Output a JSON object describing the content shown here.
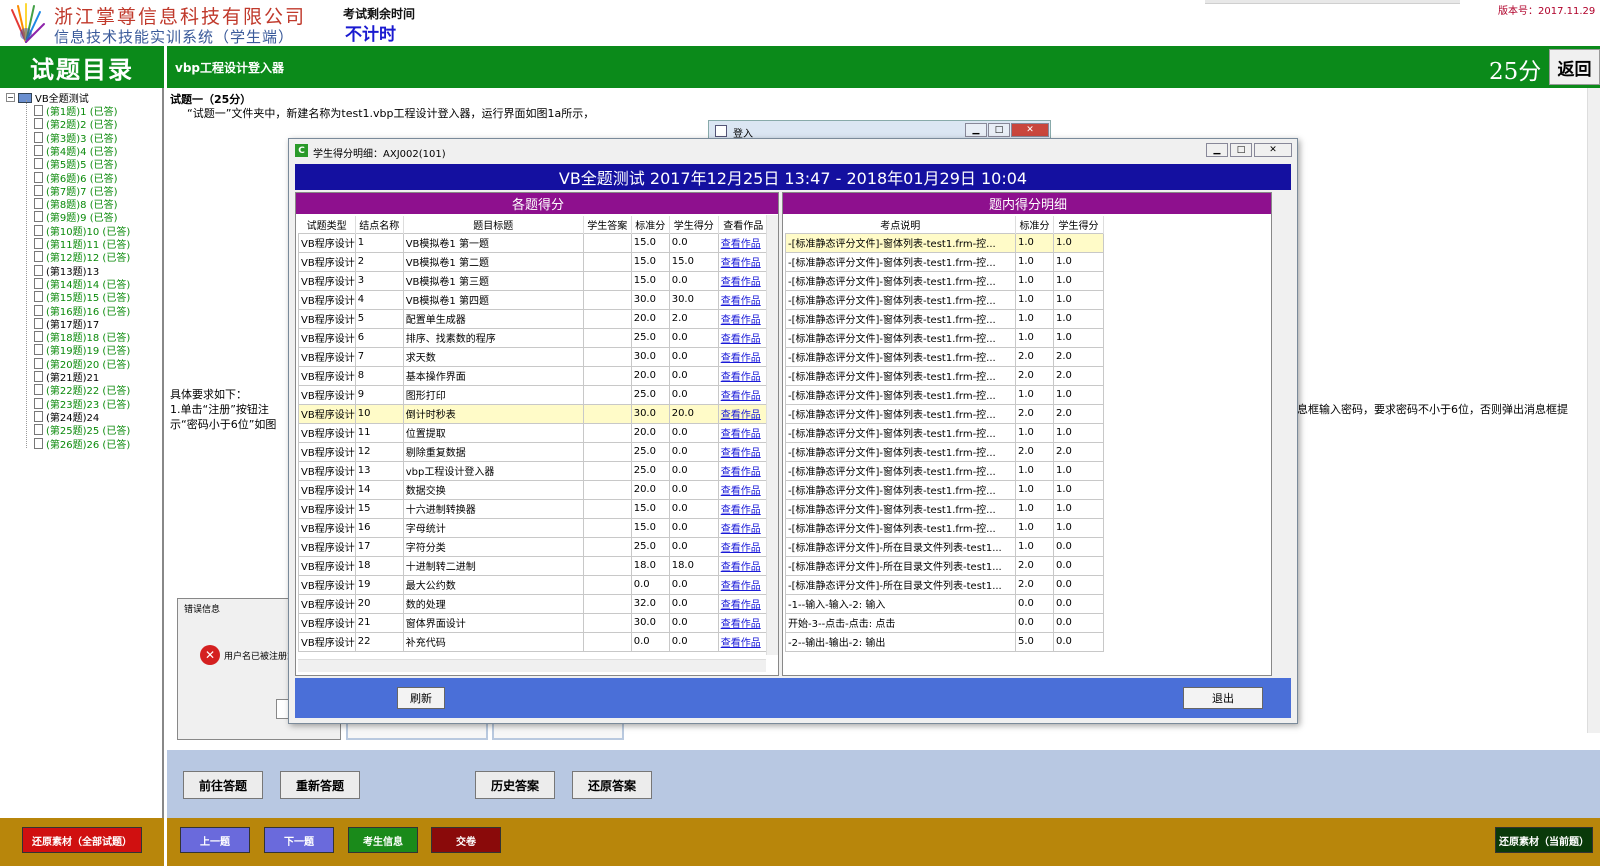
{
  "header": {
    "company": "浙江掌尊信息科技有限公司",
    "system": "信息技术技能实训系统（学生端）",
    "time_label": "考试剩余时间",
    "time_value": "不计时",
    "version": "版本号：2017.11.29"
  },
  "green_bar": {
    "catalog_title": "试题目录",
    "question_title": "vbp工程设计登入器",
    "score": "25分",
    "back_label": "返回"
  },
  "tree": {
    "root": "VB全题测试",
    "items": [
      {
        "label": "(第1题)1 (已答)",
        "done": true
      },
      {
        "label": "(第2题)2 (已答)",
        "done": true
      },
      {
        "label": "(第3题)3 (已答)",
        "done": true
      },
      {
        "label": "(第4题)4 (已答)",
        "done": true
      },
      {
        "label": "(第5题)5 (已答)",
        "done": true
      },
      {
        "label": "(第6题)6 (已答)",
        "done": true
      },
      {
        "label": "(第7题)7 (已答)",
        "done": true
      },
      {
        "label": "(第8题)8 (已答)",
        "done": true
      },
      {
        "label": "(第9题)9 (已答)",
        "done": true
      },
      {
        "label": "(第10题)10 (已答)",
        "done": true
      },
      {
        "label": "(第11题)11 (已答)",
        "done": true
      },
      {
        "label": "(第12题)12 (已答)",
        "done": true
      },
      {
        "label": "(第13题)13",
        "done": false
      },
      {
        "label": "(第14题)14 (已答)",
        "done": true
      },
      {
        "label": "(第15题)15 (已答)",
        "done": true
      },
      {
        "label": "(第16题)16 (已答)",
        "done": true
      },
      {
        "label": "(第17题)17",
        "done": false
      },
      {
        "label": "(第18题)18 (已答)",
        "done": true
      },
      {
        "label": "(第19题)19 (已答)",
        "done": true
      },
      {
        "label": "(第20题)20 (已答)",
        "done": true
      },
      {
        "label": "(第21题)21",
        "done": false
      },
      {
        "label": "(第22题)22 (已答)",
        "done": true
      },
      {
        "label": "(第23题)23 (已答)",
        "done": true
      },
      {
        "label": "(第24题)24",
        "done": false
      },
      {
        "label": "(第25题)25 (已答)",
        "done": true
      },
      {
        "label": "(第26题)26 (已答)",
        "done": true
      }
    ]
  },
  "question": {
    "head": "试题一（25分）",
    "text": "“试题一”文件夹中，新建名称为test1.vbp工程设计登入器，运行界面如图1a所示，",
    "req_1": "具体要求如下：",
    "req_2": "1.单击“注册”按钮注",
    "req_3": "示“密码小于6位”如图",
    "req_right": "息框输入密码，要求密码不小于6位，否则弹出消息框提"
  },
  "login_dialog": {
    "title": "登入"
  },
  "error_dialog": {
    "title": "错误信息",
    "text": "用户名已被注册或不"
  },
  "score_dialog": {
    "title": "学生得分明细：AXJ002(101)",
    "banner": "VB全题测试 2017年12月25日 13:47 - 2018年01月29日 10:04",
    "left_panel_title": "各题得分",
    "right_panel_title": "题内得分明细",
    "left_columns": [
      "试题类型",
      "结点名称",
      "题目标题",
      "学生答案",
      "标准分",
      "学生得分",
      "查看作品"
    ],
    "right_columns": [
      "考点说明",
      "标准分",
      "学生得分"
    ],
    "left_rows": [
      [
        "VB程序设计",
        "1",
        "VB模拟卷1 第一题",
        "",
        "15.0",
        "0.0",
        "查看作品"
      ],
      [
        "VB程序设计",
        "2",
        "VB模拟卷1 第二题",
        "",
        "15.0",
        "15.0",
        "查看作品"
      ],
      [
        "VB程序设计",
        "3",
        "VB模拟卷1 第三题",
        "",
        "15.0",
        "0.0",
        "查看作品"
      ],
      [
        "VB程序设计",
        "4",
        "VB模拟卷1 第四题",
        "",
        "30.0",
        "30.0",
        "查看作品"
      ],
      [
        "VB程序设计",
        "5",
        "配置单生成器",
        "",
        "20.0",
        "2.0",
        "查看作品"
      ],
      [
        "VB程序设计",
        "6",
        "排序、找素数的程序",
        "",
        "25.0",
        "0.0",
        "查看作品"
      ],
      [
        "VB程序设计",
        "7",
        "求天数",
        "",
        "30.0",
        "0.0",
        "查看作品"
      ],
      [
        "VB程序设计",
        "8",
        "基本操作界面",
        "",
        "20.0",
        "0.0",
        "查看作品"
      ],
      [
        "VB程序设计",
        "9",
        "图形打印",
        "",
        "25.0",
        "0.0",
        "查看作品"
      ],
      [
        "VB程序设计",
        "10",
        "倒计时秒表",
        "",
        "30.0",
        "20.0",
        "查看作品"
      ],
      [
        "VB程序设计",
        "11",
        "位置提取",
        "",
        "20.0",
        "0.0",
        "查看作品"
      ],
      [
        "VB程序设计",
        "12",
        "剔除重复数据",
        "",
        "25.0",
        "0.0",
        "查看作品"
      ],
      [
        "VB程序设计",
        "13",
        "vbp工程设计登入器",
        "",
        "25.0",
        "0.0",
        "查看作品"
      ],
      [
        "VB程序设计",
        "14",
        "数据交换",
        "",
        "20.0",
        "0.0",
        "查看作品"
      ],
      [
        "VB程序设计",
        "15",
        "十六进制转换器",
        "",
        "15.0",
        "0.0",
        "查看作品"
      ],
      [
        "VB程序设计",
        "16",
        "字母统计",
        "",
        "15.0",
        "0.0",
        "查看作品"
      ],
      [
        "VB程序设计",
        "17",
        "字符分类",
        "",
        "25.0",
        "0.0",
        "查看作品"
      ],
      [
        "VB程序设计",
        "18",
        "十进制转二进制",
        "",
        "18.0",
        "18.0",
        "查看作品"
      ],
      [
        "VB程序设计",
        "19",
        "最大公约数",
        "",
        "0.0",
        "0.0",
        "查看作品"
      ],
      [
        "VB程序设计",
        "20",
        "数的处理",
        "",
        "32.0",
        "0.0",
        "查看作品"
      ],
      [
        "VB程序设计",
        "21",
        "窗体界面设计",
        "",
        "30.0",
        "0.0",
        "查看作品"
      ],
      [
        "VB程序设计",
        "22",
        "补充代码",
        "",
        "0.0",
        "0.0",
        "查看作品"
      ]
    ],
    "right_rows": [
      [
        "-[标准静态评分文件]-窗体列表-test1.frm-控...",
        "1.0",
        "1.0"
      ],
      [
        "-[标准静态评分文件]-窗体列表-test1.frm-控...",
        "1.0",
        "1.0"
      ],
      [
        "-[标准静态评分文件]-窗体列表-test1.frm-控...",
        "1.0",
        "1.0"
      ],
      [
        "-[标准静态评分文件]-窗体列表-test1.frm-控...",
        "1.0",
        "1.0"
      ],
      [
        "-[标准静态评分文件]-窗体列表-test1.frm-控...",
        "1.0",
        "1.0"
      ],
      [
        "-[标准静态评分文件]-窗体列表-test1.frm-控...",
        "1.0",
        "1.0"
      ],
      [
        "-[标准静态评分文件]-窗体列表-test1.frm-控...",
        "2.0",
        "2.0"
      ],
      [
        "-[标准静态评分文件]-窗体列表-test1.frm-控...",
        "2.0",
        "2.0"
      ],
      [
        "-[标准静态评分文件]-窗体列表-test1.frm-控...",
        "1.0",
        "1.0"
      ],
      [
        "-[标准静态评分文件]-窗体列表-test1.frm-控...",
        "2.0",
        "2.0"
      ],
      [
        "-[标准静态评分文件]-窗体列表-test1.frm-控...",
        "1.0",
        "1.0"
      ],
      [
        "-[标准静态评分文件]-窗体列表-test1.frm-控...",
        "2.0",
        "2.0"
      ],
      [
        "-[标准静态评分文件]-窗体列表-test1.frm-控...",
        "1.0",
        "1.0"
      ],
      [
        "-[标准静态评分文件]-窗体列表-test1.frm-控...",
        "1.0",
        "1.0"
      ],
      [
        "-[标准静态评分文件]-窗体列表-test1.frm-控...",
        "1.0",
        "1.0"
      ],
      [
        "-[标准静态评分文件]-窗体列表-test1.frm-控...",
        "1.0",
        "1.0"
      ],
      [
        "-[标准静态评分文件]-所在目录文件列表-test1...",
        "1.0",
        "0.0"
      ],
      [
        "-[标准静态评分文件]-所在目录文件列表-test1...",
        "2.0",
        "0.0"
      ],
      [
        "-[标准静态评分文件]-所在目录文件列表-test1...",
        "2.0",
        "0.0"
      ],
      [
        "-1--输入-输入-2: 输入",
        "0.0",
        "0.0"
      ],
      [
        "开始-3--点击-点击: 点击",
        "0.0",
        "0.0"
      ],
      [
        "-2--输出-输出-2: 输出",
        "5.0",
        "0.0"
      ]
    ],
    "refresh_label": "刷新",
    "exit_label": "退出"
  },
  "actions": {
    "goto_answer": "前往答题",
    "reanswer": "重新答题",
    "history": "历史答案",
    "restore": "还原答案"
  },
  "footer": {
    "restore_all": "还原素材（全部试题）",
    "prev": "上一题",
    "next": "下一题",
    "student_info": "考生信息",
    "submit": "交卷",
    "restore_current": "还原素材（当前题）"
  },
  "colors": {
    "green": "#0b8a1a",
    "purple": "#8e108e",
    "banner_blue": "#1410a0",
    "footer_gold": "#b8860b",
    "highlight_yellow": "#fffbc8"
  }
}
